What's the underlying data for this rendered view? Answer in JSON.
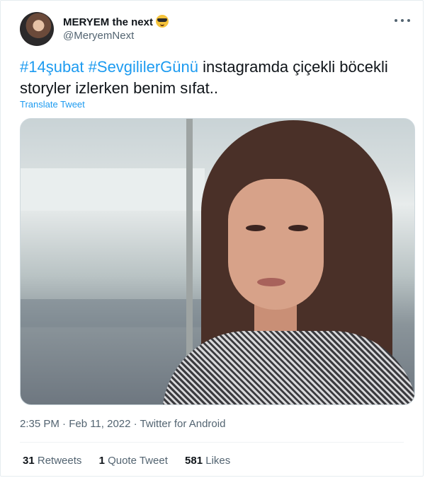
{
  "tweet": {
    "author_name": "MERYEM the next",
    "author_emoji": "smiling-face-with-sunglasses-icon",
    "author_handle": "@MeryemNext",
    "hashtag1": "#14şubat",
    "hashtag2": "#SevgililerGünü",
    "text_rest": "instagramda çiçekli böcekli storyler izlerken benim sıfat..",
    "translate_label": "Translate Tweet",
    "meta": "2:35 PM · Feb 11, 2022 · Twitter for Android",
    "stats": {
      "retweets_count": "31",
      "retweets_label": "Retweets",
      "quote_count": "1",
      "quote_label": "Quote Tweet",
      "likes_count": "581",
      "likes_label": "Likes"
    }
  },
  "colors": {
    "link": "#1d9bf0",
    "text": "#0f1419",
    "muted": "#536471"
  }
}
